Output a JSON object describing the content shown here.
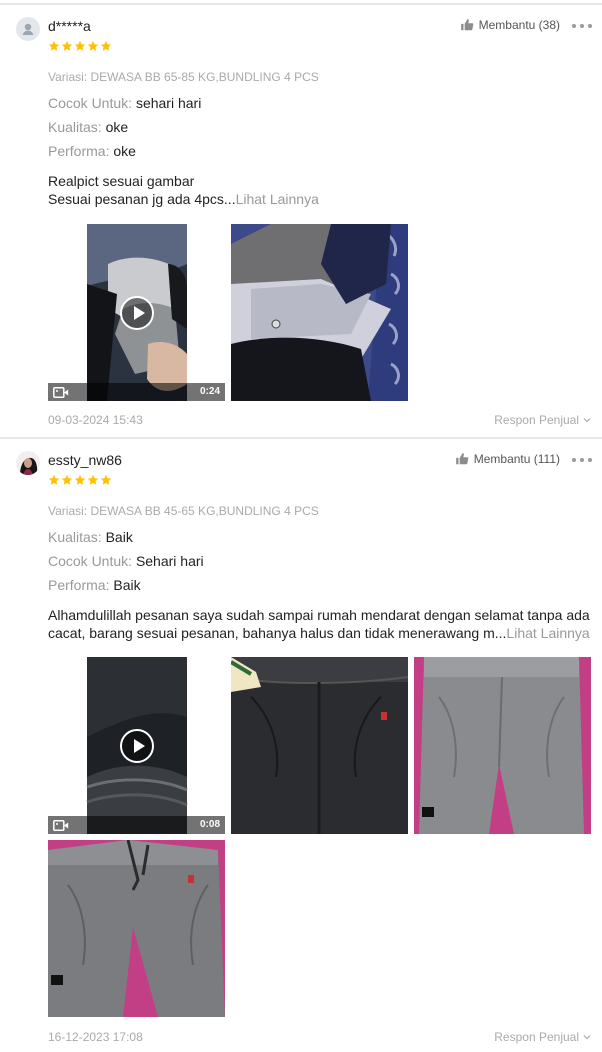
{
  "reviews": [
    {
      "username": "d*****a",
      "rating": 5,
      "helpful_label": "Membantu (38)",
      "variant": "Variasi: DEWASA BB 65-85 KG,BUNDLING 4 PCS",
      "attributes": [
        {
          "key": "Cocok Untuk:",
          "value": "sehari hari"
        },
        {
          "key": "Kualitas:",
          "value": "oke"
        },
        {
          "key": "Performa:",
          "value": "oke"
        }
      ],
      "text_lines": [
        "Realpict sesuai gambar",
        "Sesuai pesanan jg ada 4pcs..."
      ],
      "see_more": "Lihat Lainnya",
      "video_duration": "0:24",
      "date": "09-03-2024 15:43",
      "seller_response": "Respon Penjual"
    },
    {
      "username": "essty_nw86",
      "rating": 5,
      "helpful_label": "Membantu (111)",
      "variant": "Variasi: DEWASA BB 45-65 KG,BUNDLING 4 PCS",
      "attributes": [
        {
          "key": "Kualitas:",
          "value": "Baik"
        },
        {
          "key": "Cocok Untuk:",
          "value": "Sehari hari"
        },
        {
          "key": "Performa:",
          "value": "Baik"
        }
      ],
      "text_lines": [
        "Alhamdulillah pesanan saya sudah sampai rumah mendarat dengan selamat tanpa ada",
        "cacat, barang sesuai pesanan, bahanya halus dan tidak menerawang m..."
      ],
      "see_more": "Lihat Lainnya",
      "video_duration": "0:08",
      "date": "16-12-2023 17:08",
      "seller_response": "Respon Penjual"
    }
  ],
  "colors": {
    "star": "#ffc107",
    "muted": "#aaaaaa",
    "label": "#999999"
  },
  "icons": [
    "user-avatar-icon",
    "star-icon",
    "thumbs-up-icon",
    "more-dots-icon",
    "play-icon",
    "video-camera-icon",
    "chevron-down-icon"
  ]
}
